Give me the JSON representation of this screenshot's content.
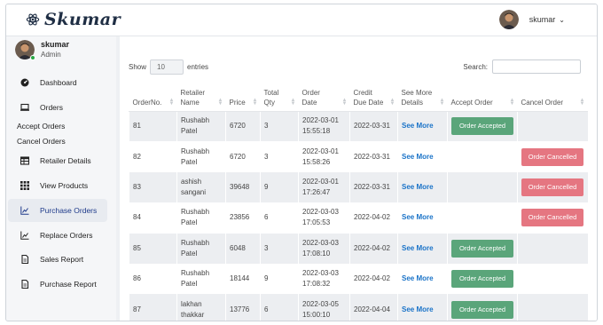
{
  "brand": {
    "name": "Skumar"
  },
  "topbar": {
    "user_name": "skumar"
  },
  "profile": {
    "name": "skumar",
    "role": "Admin"
  },
  "sidebar": {
    "items": [
      {
        "label": "Dashboard",
        "icon": "dashboard-icon"
      },
      {
        "label": "Orders",
        "icon": "monitor-icon"
      },
      {
        "label": "Retailer Details",
        "icon": "table-icon"
      },
      {
        "label": "View Products",
        "icon": "grid-icon"
      },
      {
        "label": "Purchase Orders",
        "icon": "chart-icon",
        "active": true
      },
      {
        "label": "Replace Orders",
        "icon": "chart-icon"
      },
      {
        "label": "Sales Report",
        "icon": "document-icon"
      },
      {
        "label": "Purchase Report",
        "icon": "document-icon"
      }
    ],
    "sub_items": [
      "Accept Orders",
      "Cancel Orders"
    ]
  },
  "controls": {
    "show_label": "Show",
    "entries_value": "10",
    "entries_label": "entries",
    "search_label": "Search:"
  },
  "table": {
    "headers": [
      [
        "OrderNo."
      ],
      [
        "Retailer",
        "Name"
      ],
      [
        "Price"
      ],
      [
        "Total",
        "Qty"
      ],
      [
        "Order",
        "Date"
      ],
      [
        "Credit",
        "Due Date"
      ],
      [
        "See More",
        "Details"
      ],
      [
        "Accept Order"
      ],
      [
        "Cancel Order"
      ]
    ],
    "rows": [
      {
        "order_no": "81",
        "retailer": [
          "Rushabh",
          "Patel"
        ],
        "price": "6720",
        "qty": "3",
        "order_date": [
          "2022-03-01",
          "15:55:18"
        ],
        "due_date": "2022-03-31",
        "details": "See More",
        "accept": "Order Accepted",
        "cancel": ""
      },
      {
        "order_no": "82",
        "retailer": [
          "Rushabh",
          "Patel"
        ],
        "price": "6720",
        "qty": "3",
        "order_date": [
          "2022-03-01",
          "15:58:26"
        ],
        "due_date": "2022-03-31",
        "details": "See More",
        "accept": "",
        "cancel": "Order Cancelled"
      },
      {
        "order_no": "83",
        "retailer": [
          "ashish",
          "sangani"
        ],
        "price": "39648",
        "qty": "9",
        "order_date": [
          "2022-03-01",
          "17:26:47"
        ],
        "due_date": "2022-03-31",
        "details": "See More",
        "accept": "",
        "cancel": "Order Cancelled"
      },
      {
        "order_no": "84",
        "retailer": [
          "Rushabh",
          "Patel"
        ],
        "price": "23856",
        "qty": "6",
        "order_date": [
          "2022-03-03",
          "17:05:53"
        ],
        "due_date": "2022-04-02",
        "details": "See More",
        "accept": "",
        "cancel": "Order Cancelled"
      },
      {
        "order_no": "85",
        "retailer": [
          "Rushabh",
          "Patel"
        ],
        "price": "6048",
        "qty": "3",
        "order_date": [
          "2022-03-03",
          "17:08:10"
        ],
        "due_date": "2022-04-02",
        "details": "See More",
        "accept": "Order Accepted",
        "cancel": ""
      },
      {
        "order_no": "86",
        "retailer": [
          "Rushabh",
          "Patel"
        ],
        "price": "18144",
        "qty": "9",
        "order_date": [
          "2022-03-03",
          "17:08:32"
        ],
        "due_date": "2022-04-02",
        "details": "See More",
        "accept": "Order Accepted",
        "cancel": ""
      },
      {
        "order_no": "87",
        "retailer": [
          "lakhan",
          "thakkar"
        ],
        "price": "13776",
        "qty": "6",
        "order_date": [
          "2022-03-05",
          "15:00:10"
        ],
        "due_date": "2022-04-04",
        "details": "See More",
        "accept": "Order Accepted",
        "cancel": ""
      }
    ]
  },
  "colors": {
    "accept": "#5aa57a",
    "cancel": "#e57681",
    "link": "#1a73c8",
    "row_stripe": "#eceef1"
  }
}
